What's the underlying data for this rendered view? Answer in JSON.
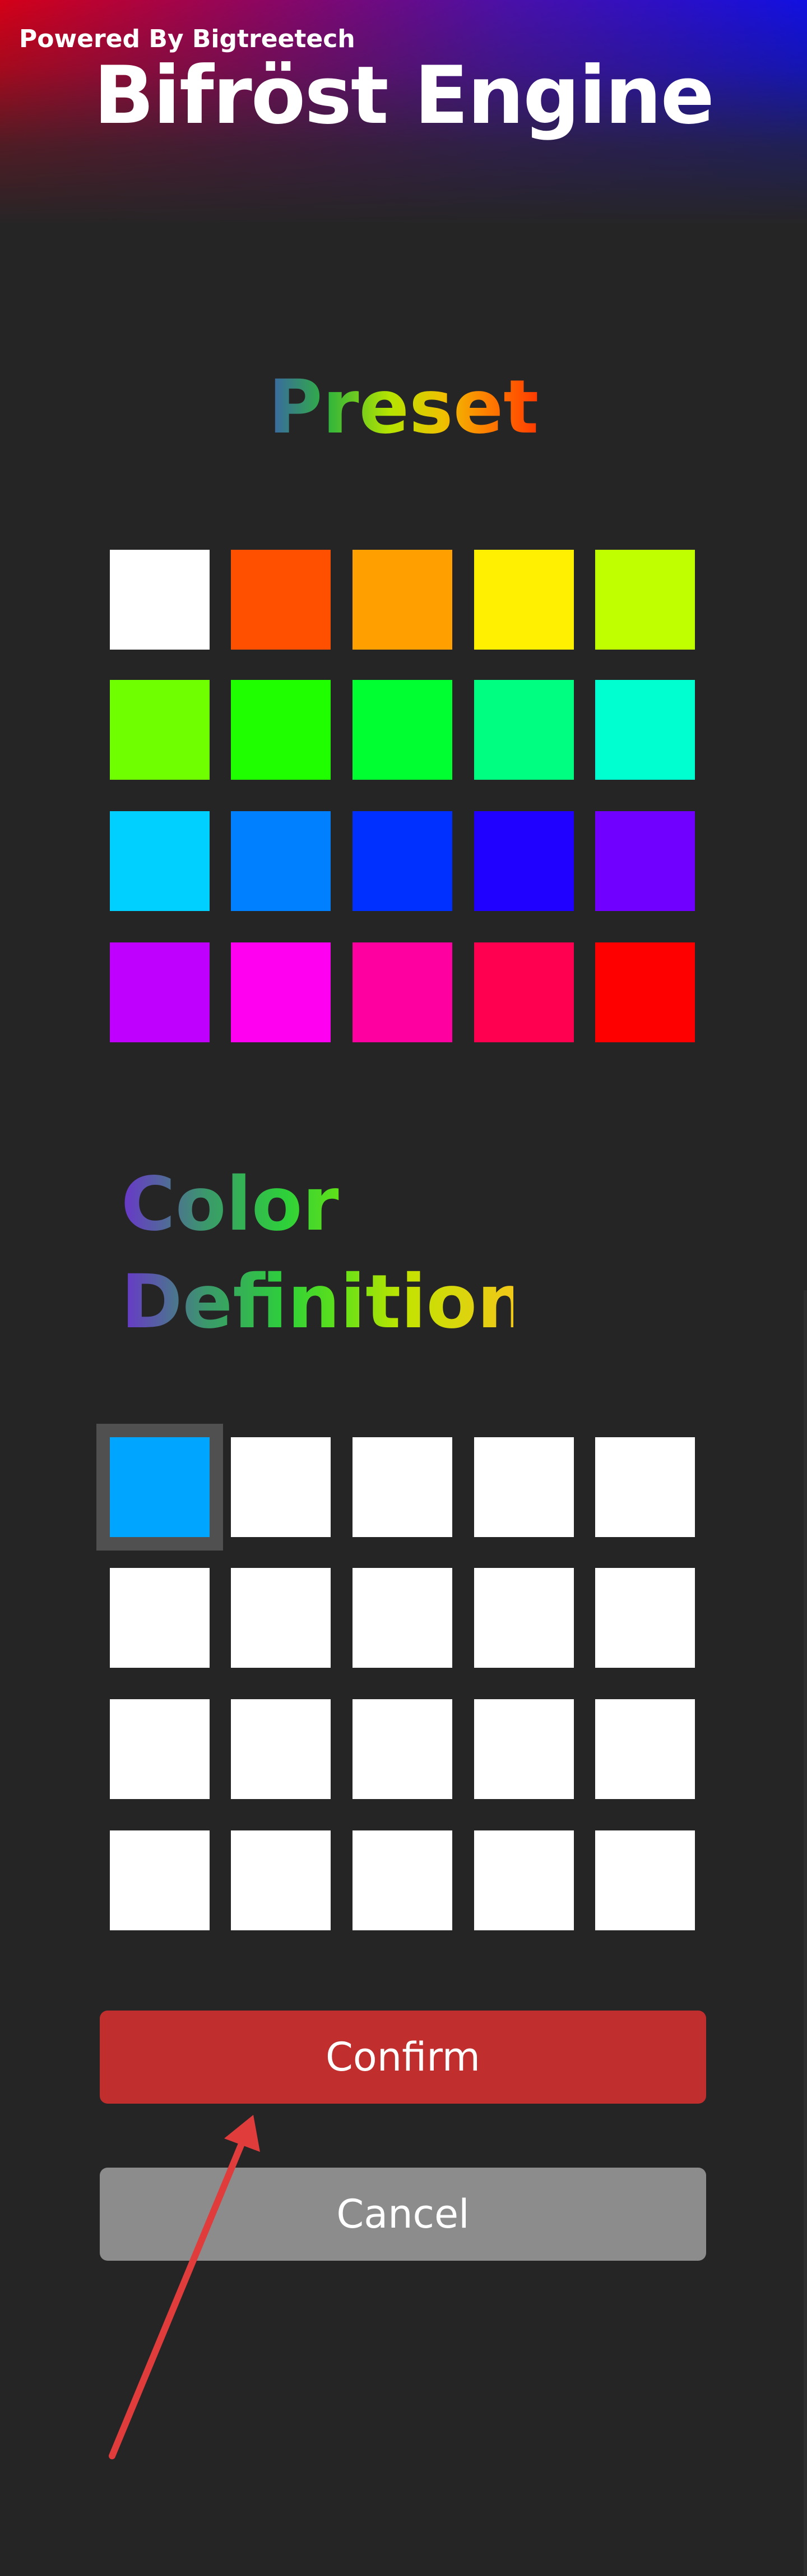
{
  "header": {
    "powered_by": "Powered By Bigtreetech",
    "brand_name": "Bifröst Engine",
    "gradient_colors": [
      "#d40017",
      "#8a0664",
      "#4a10a8",
      "#0a10e8"
    ]
  },
  "preset": {
    "title": "Preset",
    "swatches": [
      "#ffffff",
      "#ff5000",
      "#ff9f00",
      "#ffef00",
      "#bfff00",
      "#70ff00",
      "#1fff00",
      "#00ff30",
      "#00ff80",
      "#00ffd0",
      "#00d0ff",
      "#0080ff",
      "#0030ff",
      "#2000ff",
      "#7000ff",
      "#bf00ff",
      "#ff00f0",
      "#ff00a0",
      "#ff0050",
      "#ff0000"
    ]
  },
  "color_definition": {
    "title": "Color Definition",
    "selected_index": 0,
    "swatches": [
      "#00a5ff",
      "#ffffff",
      "#ffffff",
      "#ffffff",
      "#ffffff",
      "#ffffff",
      "#ffffff",
      "#ffffff",
      "#ffffff",
      "#ffffff",
      "#ffffff",
      "#ffffff",
      "#ffffff",
      "#ffffff",
      "#ffffff",
      "#ffffff",
      "#ffffff",
      "#ffffff",
      "#ffffff",
      "#ffffff"
    ]
  },
  "actions": {
    "confirm_label": "Confirm",
    "cancel_label": "Cancel",
    "confirm_color": "#c02e2e",
    "cancel_color": "#8c8c8c"
  },
  "annotation": {
    "arrow_color": "#e03c3c",
    "points_to": "confirm-button"
  }
}
